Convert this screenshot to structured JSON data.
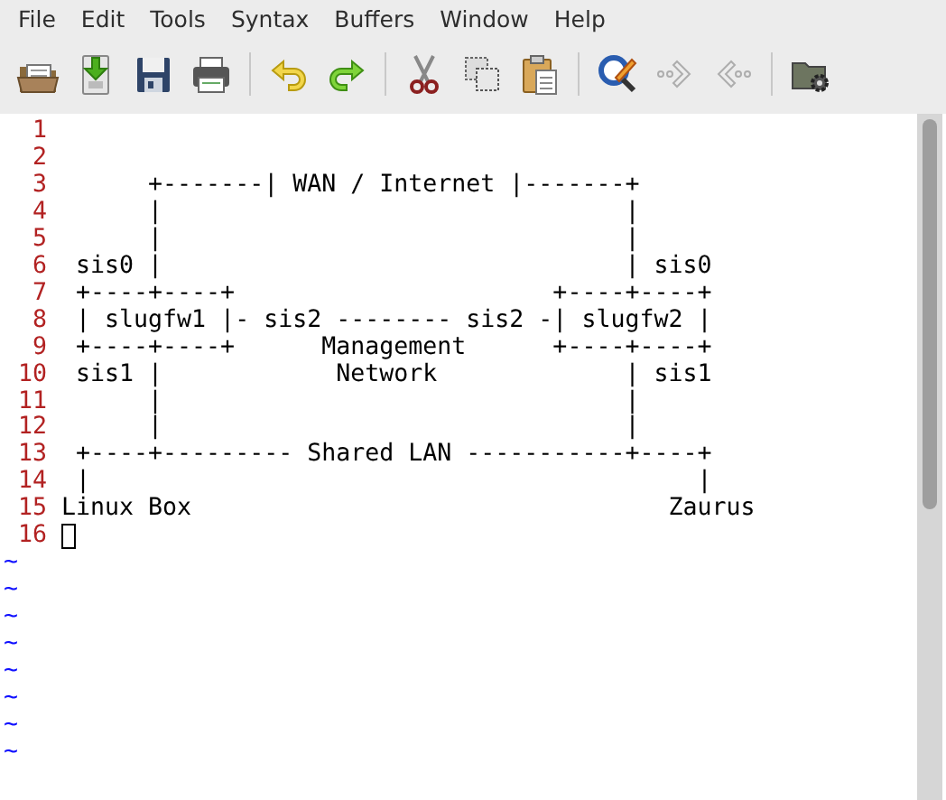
{
  "menu": [
    "File",
    "Edit",
    "Tools",
    "Syntax",
    "Buffers",
    "Window",
    "Help"
  ],
  "toolbar": [
    [
      {
        "kind": "open",
        "disabled": false
      },
      {
        "kind": "load",
        "disabled": false
      },
      {
        "kind": "save",
        "disabled": false
      },
      {
        "kind": "print",
        "disabled": false
      }
    ],
    [
      {
        "kind": "undo",
        "disabled": false
      },
      {
        "kind": "redo",
        "disabled": false
      }
    ],
    [
      {
        "kind": "cut",
        "disabled": false
      },
      {
        "kind": "copy",
        "disabled": false
      },
      {
        "kind": "paste",
        "disabled": false
      }
    ],
    [
      {
        "kind": "find",
        "disabled": false
      },
      {
        "kind": "next",
        "disabled": true
      },
      {
        "kind": "prev",
        "disabled": true
      }
    ],
    [
      {
        "kind": "folder-gear",
        "disabled": false
      }
    ]
  ],
  "lines": [
    {
      "number": "1",
      "cursor": false
    },
    {
      "number": "2",
      "cursor": false
    },
    {
      "number": "3",
      "text": "      +-------| WAN / Internet |-------+",
      "cursor": false
    },
    {
      "number": "4",
      "text": "      |                                |",
      "cursor": false
    },
    {
      "number": "5",
      "text": "      |                                |",
      "cursor": false
    },
    {
      "number": "6",
      "text": " sis0 |                                | sis0",
      "cursor": false
    },
    {
      "number": "7",
      "text": " +----+----+                      +----+----+",
      "cursor": false
    },
    {
      "number": "8",
      "text": " | slugfw1 |- sis2 -------- sis2 -| slugfw2 |",
      "cursor": false
    },
    {
      "number": "9",
      "text": " +----+----+      Management      +----+----+",
      "cursor": false
    },
    {
      "number": "10",
      "text": " sis1 |            Network             | sis1",
      "cursor": false
    },
    {
      "number": "11",
      "text": "      |                                |",
      "cursor": false
    },
    {
      "number": "12",
      "text": "      |                                |",
      "cursor": false
    },
    {
      "number": "13",
      "text": " +----+--------- Shared LAN -----------+----+",
      "cursor": false
    },
    {
      "number": "14",
      "text": " |                                          |",
      "cursor": false
    },
    {
      "number": "15",
      "text": "Linux Box                                 Zaurus",
      "cursor": false
    },
    {
      "number": "16",
      "cursor": true
    }
  ],
  "filler": [
    "~",
    "~",
    "~",
    "~",
    "~",
    "~",
    "~",
    "~"
  ]
}
